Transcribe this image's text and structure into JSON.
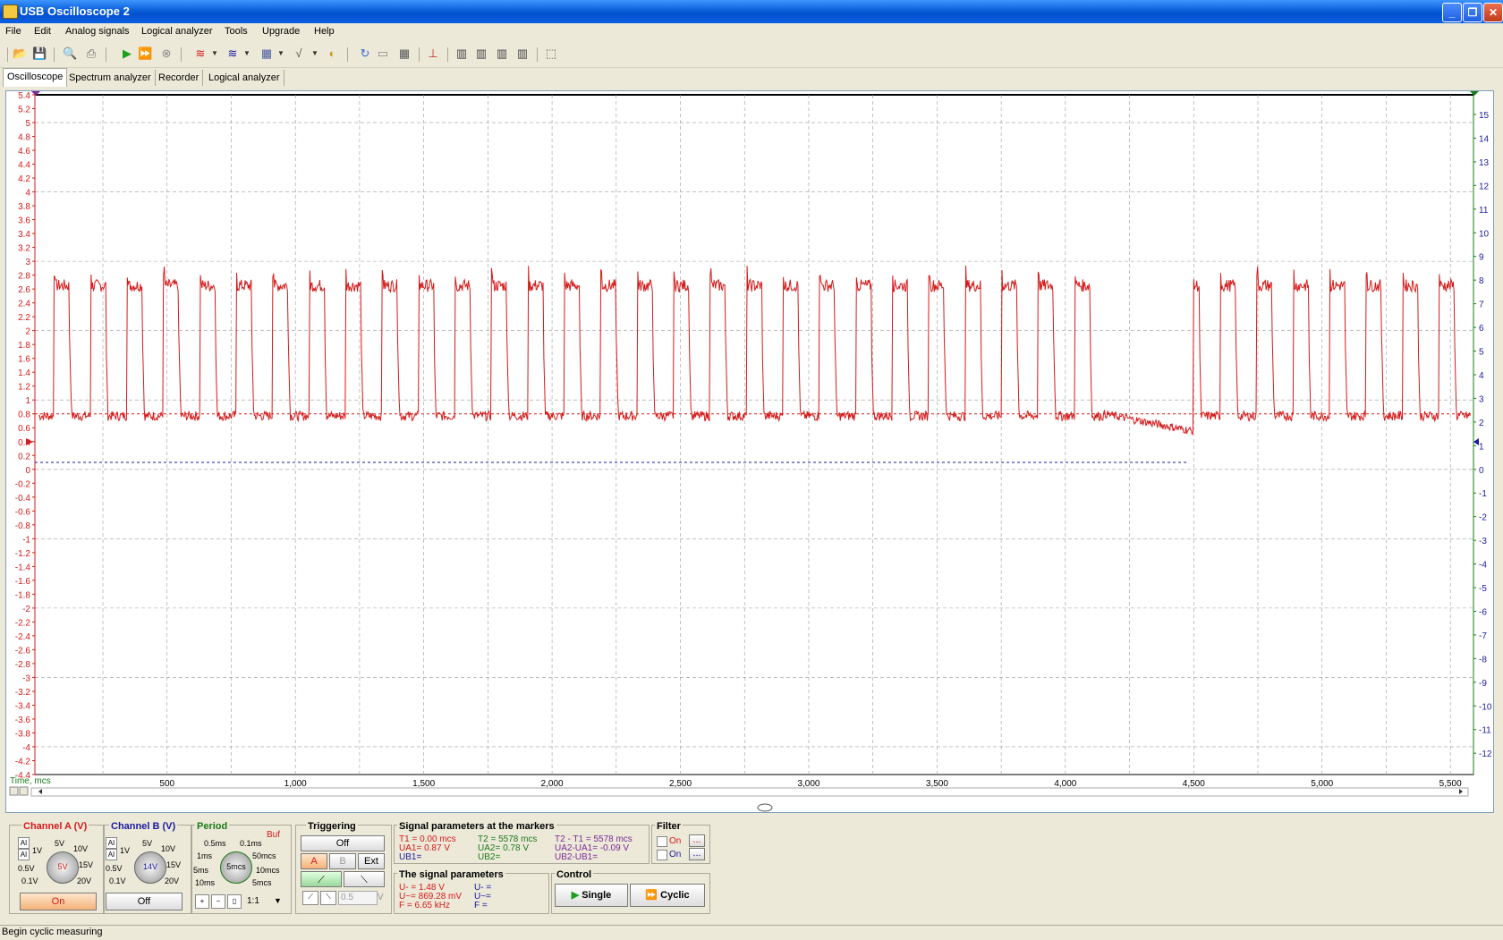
{
  "window": {
    "title": "USB Oscilloscope 2",
    "btn_min": "_",
    "btn_restore": "❐",
    "btn_close": "✕"
  },
  "menu": [
    "File",
    "Edit",
    "Analog signals",
    "Logical analyzer",
    "Tools",
    "Upgrade",
    "Help"
  ],
  "tabs": [
    "Oscilloscope",
    "Spectrum analyzer",
    "Recorder",
    "Logical analyzer"
  ],
  "plot": {
    "left_axis": [
      "5.4",
      "5.2",
      "5",
      "4.8",
      "4.6",
      "4.4",
      "4.2",
      "4",
      "3.8",
      "3.6",
      "3.4",
      "3.2",
      "3",
      "2.8",
      "2.6",
      "2.4",
      "2.2",
      "2",
      "1.8",
      "1.6",
      "1.4",
      "1.2",
      "1",
      "0.8",
      "0.6",
      "0.4",
      "0.2",
      "0",
      "-0.2",
      "-0.4",
      "-0.6",
      "-0.8",
      "-1",
      "-1.2",
      "-1.4",
      "-1.6",
      "-1.8",
      "-2",
      "-2.2",
      "-2.4",
      "-2.6",
      "-2.8",
      "-3",
      "-3.2",
      "-3.4",
      "-3.6",
      "-3.8",
      "-4",
      "-4.2",
      "-4.4"
    ],
    "right_axis": [
      "15",
      "14",
      "13",
      "12",
      "11",
      "10",
      "9",
      "8",
      "7",
      "6",
      "5",
      "4",
      "3",
      "2",
      "1",
      "0",
      "-1",
      "-2",
      "-3",
      "-4",
      "-5",
      "-6",
      "-7",
      "-8",
      "-9",
      "-10",
      "-11",
      "-12"
    ],
    "x_axis": [
      "500",
      "1,000",
      "1,500",
      "2,000",
      "2,500",
      "3,000",
      "3,500",
      "4,000",
      "4,500",
      "5,000",
      "5,500"
    ],
    "time_label": "Time, mcs",
    "colors": {
      "channel_a": "#d41a1a",
      "channel_b": "#1a1aa0",
      "right_axis": "#1a7a1a",
      "grid": "#9a9a9a"
    }
  },
  "channel_a": {
    "title": "Channel A (V)",
    "knob": "5V",
    "labels": [
      "5V",
      "10V",
      "1V",
      "15V",
      "0.5V",
      "20V",
      "0.1V"
    ],
    "button": "On"
  },
  "channel_b": {
    "title": "Channel B (V)",
    "knob": "14V",
    "labels": [
      "5V",
      "10V",
      "1V",
      "15V",
      "0.5V",
      "20V",
      "0.1V"
    ],
    "button": "Off"
  },
  "period": {
    "title": "Period",
    "buf": "Buf",
    "knob": "5mcs",
    "labels": [
      "0.5ms",
      "0.1ms",
      "1ms",
      "50mcs",
      "5ms",
      "10mcs",
      "10ms",
      "5mcs"
    ],
    "ratio": "1:1"
  },
  "triggering": {
    "title": "Triggering",
    "mode": "Off",
    "src_a": "A",
    "src_b": "B",
    "src_ext": "Ext",
    "level": "0.5",
    "unit": "V"
  },
  "markers": {
    "title": "Signal parameters at the markers",
    "t1": "T1 = 0.00 mcs",
    "ua1": "UA1= 0.87 V",
    "ub1": "UB1=",
    "t2": "T2 = 5578 mcs",
    "ua2": "UA2= 0.78 V",
    "ub2": "UB2=",
    "dt": "T2 - T1 = 5578 mcs",
    "dua": "UA2-UA1= -0.09 V",
    "dub": "UB2-UB1="
  },
  "filter": {
    "title": "Filter",
    "on1": "On",
    "on2": "On",
    "dots": "..."
  },
  "params": {
    "title": "The signal parameters",
    "u_dc": "U- = 1.48 V",
    "u_ac": "U~= 869.28 mV",
    "freq": "F = 6.65 kHz",
    "ub_dc": "U- =",
    "ub_ac": "U~=",
    "fb": "F ="
  },
  "control": {
    "title": "Control",
    "single": "Single",
    "cyclic": "Cyclic"
  },
  "status": "Begin cyclic measuring"
}
